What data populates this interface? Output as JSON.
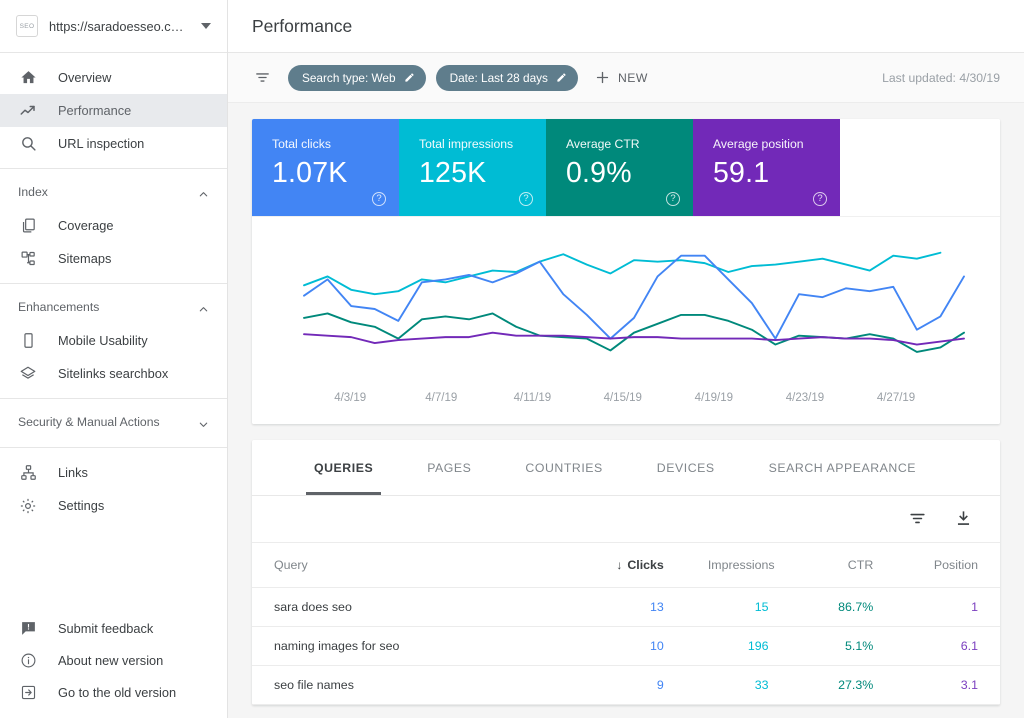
{
  "sidebar": {
    "property": {
      "logo_text": "SEO",
      "url": "https://saradoesseo.com/",
      "caret_icon": "chevron-down-icon"
    },
    "primary_items": [
      {
        "label": "Overview",
        "icon": "home-icon",
        "active": false
      },
      {
        "label": "Performance",
        "icon": "trending-up-icon",
        "active": true
      },
      {
        "label": "URL inspection",
        "icon": "search-icon",
        "active": false
      }
    ],
    "sections": [
      {
        "title": "Index",
        "expanded": true,
        "chevron": "chevron-up-icon",
        "items": [
          {
            "label": "Coverage",
            "icon": "documents-icon"
          },
          {
            "label": "Sitemaps",
            "icon": "sitemap-icon"
          }
        ]
      },
      {
        "title": "Enhancements",
        "expanded": true,
        "chevron": "chevron-up-icon",
        "items": [
          {
            "label": "Mobile Usability",
            "icon": "mobile-icon"
          },
          {
            "label": "Sitelinks searchbox",
            "icon": "layers-icon"
          }
        ]
      },
      {
        "title": "Security & Manual Actions",
        "expanded": false,
        "chevron": "chevron-down-icon",
        "items": []
      }
    ],
    "tools_items": [
      {
        "label": "Links",
        "icon": "links-icon"
      },
      {
        "label": "Settings",
        "icon": "gear-icon"
      }
    ],
    "bottom_items": [
      {
        "label": "Submit feedback",
        "icon": "feedback-icon"
      },
      {
        "label": "About new version",
        "icon": "info-icon"
      },
      {
        "label": "Go to the old version",
        "icon": "exit-icon"
      }
    ]
  },
  "header": {
    "title": "Performance"
  },
  "filterbar": {
    "funnel_icon": "filter-icon",
    "chips": [
      {
        "label": "Search type: Web",
        "edit_icon": "pencil-icon"
      },
      {
        "label": "Date: Last 28 days",
        "edit_icon": "pencil-icon"
      }
    ],
    "new_button": {
      "label": "NEW",
      "icon": "plus-icon"
    },
    "last_updated": "Last updated: 4/30/19"
  },
  "metrics": [
    {
      "label": "Total clicks",
      "value": "1.07K",
      "color": "#4285f4",
      "help_icon": "help-icon",
      "selected": true
    },
    {
      "label": "Total impressions",
      "value": "125K",
      "color": "#00bcd4",
      "help_icon": "help-icon",
      "selected": true
    },
    {
      "label": "Average CTR",
      "value": "0.9%",
      "color": "#00897b",
      "help_icon": "help-icon",
      "selected": true
    },
    {
      "label": "Average position",
      "value": "59.1",
      "color": "#7229b8",
      "help_icon": "help-icon",
      "selected": true
    }
  ],
  "chart_data": {
    "type": "line",
    "title": "",
    "xlabel": "",
    "ylabel": "",
    "grid": false,
    "legend": "none",
    "x_tick_labels": [
      "4/3/19",
      "4/7/19",
      "4/11/19",
      "4/15/19",
      "4/19/19",
      "4/23/19",
      "4/27/19"
    ],
    "x_tick_positions_pct": [
      7.0,
      20.8,
      34.6,
      48.3,
      62.1,
      75.9,
      89.7
    ],
    "x": [
      "4/2/19",
      "4/3/19",
      "4/4/19",
      "4/5/19",
      "4/6/19",
      "4/7/19",
      "4/8/19",
      "4/9/19",
      "4/10/19",
      "4/11/19",
      "4/12/19",
      "4/13/19",
      "4/14/19",
      "4/15/19",
      "4/16/19",
      "4/17/19",
      "4/18/19",
      "4/19/19",
      "4/20/19",
      "4/21/19",
      "4/22/19",
      "4/23/19",
      "4/24/19",
      "4/25/19",
      "4/26/19",
      "4/27/19",
      "4/28/19",
      "4/29/19"
    ],
    "ylim": [
      0,
      100
    ],
    "series": [
      {
        "name": "Total impressions",
        "color": "#00bcd4",
        "values": [
          66,
          72,
          63,
          60,
          62,
          70,
          68,
          72,
          76,
          75,
          82,
          87,
          80,
          74,
          83,
          82,
          83,
          81,
          75,
          79,
          80,
          82,
          84,
          80,
          76,
          86,
          84,
          88
        ]
      },
      {
        "name": "Total clicks",
        "color": "#4285f4",
        "values": [
          59,
          70,
          52,
          50,
          42,
          68,
          70,
          73,
          68,
          74,
          82,
          60,
          46,
          30,
          44,
          72,
          86,
          86,
          70,
          54,
          30,
          60,
          58,
          64,
          62,
          65,
          36,
          45,
          72
        ]
      },
      {
        "name": "Average CTR",
        "color": "#00897b",
        "values": [
          44,
          47,
          41,
          38,
          30,
          43,
          45,
          43,
          47,
          38,
          32,
          31,
          30,
          22,
          34,
          40,
          46,
          46,
          42,
          36,
          26,
          32,
          31,
          30,
          33,
          30,
          21,
          24,
          34
        ]
      },
      {
        "name": "Average position",
        "color": "#7229b8",
        "values": [
          33,
          32,
          31,
          27,
          29,
          30,
          31,
          31,
          34,
          32,
          32,
          32,
          31,
          30,
          31,
          31,
          30,
          30,
          30,
          30,
          29,
          30,
          31,
          30,
          30,
          29,
          26,
          28,
          30
        ]
      }
    ]
  },
  "table": {
    "tabs": [
      {
        "label": "QUERIES",
        "active": true
      },
      {
        "label": "PAGES",
        "active": false
      },
      {
        "label": "COUNTRIES",
        "active": false
      },
      {
        "label": "DEVICES",
        "active": false
      },
      {
        "label": "SEARCH APPEARANCE",
        "active": false
      }
    ],
    "tools": [
      {
        "icon": "filter-icon",
        "name": "table-filter-icon"
      },
      {
        "icon": "download-icon",
        "name": "table-download-icon"
      }
    ],
    "columns": [
      {
        "label": "Query",
        "key": "query",
        "sorted": false,
        "align": "left"
      },
      {
        "label": "Clicks",
        "key": "clicks",
        "sorted": true,
        "sort_arrow": "↓",
        "align": "right"
      },
      {
        "label": "Impressions",
        "key": "impressions",
        "sorted": false,
        "align": "right"
      },
      {
        "label": "CTR",
        "key": "ctr",
        "sorted": false,
        "align": "right"
      },
      {
        "label": "Position",
        "key": "position",
        "sorted": false,
        "align": "right"
      }
    ],
    "rows": [
      {
        "query": "sara does seo",
        "clicks": "13",
        "impressions": "15",
        "ctr": "86.7%",
        "position": "1"
      },
      {
        "query": "naming images for seo",
        "clicks": "10",
        "impressions": "196",
        "ctr": "5.1%",
        "position": "6.1"
      },
      {
        "query": "seo file names",
        "clicks": "9",
        "impressions": "33",
        "ctr": "27.3%",
        "position": "3.1"
      }
    ]
  }
}
